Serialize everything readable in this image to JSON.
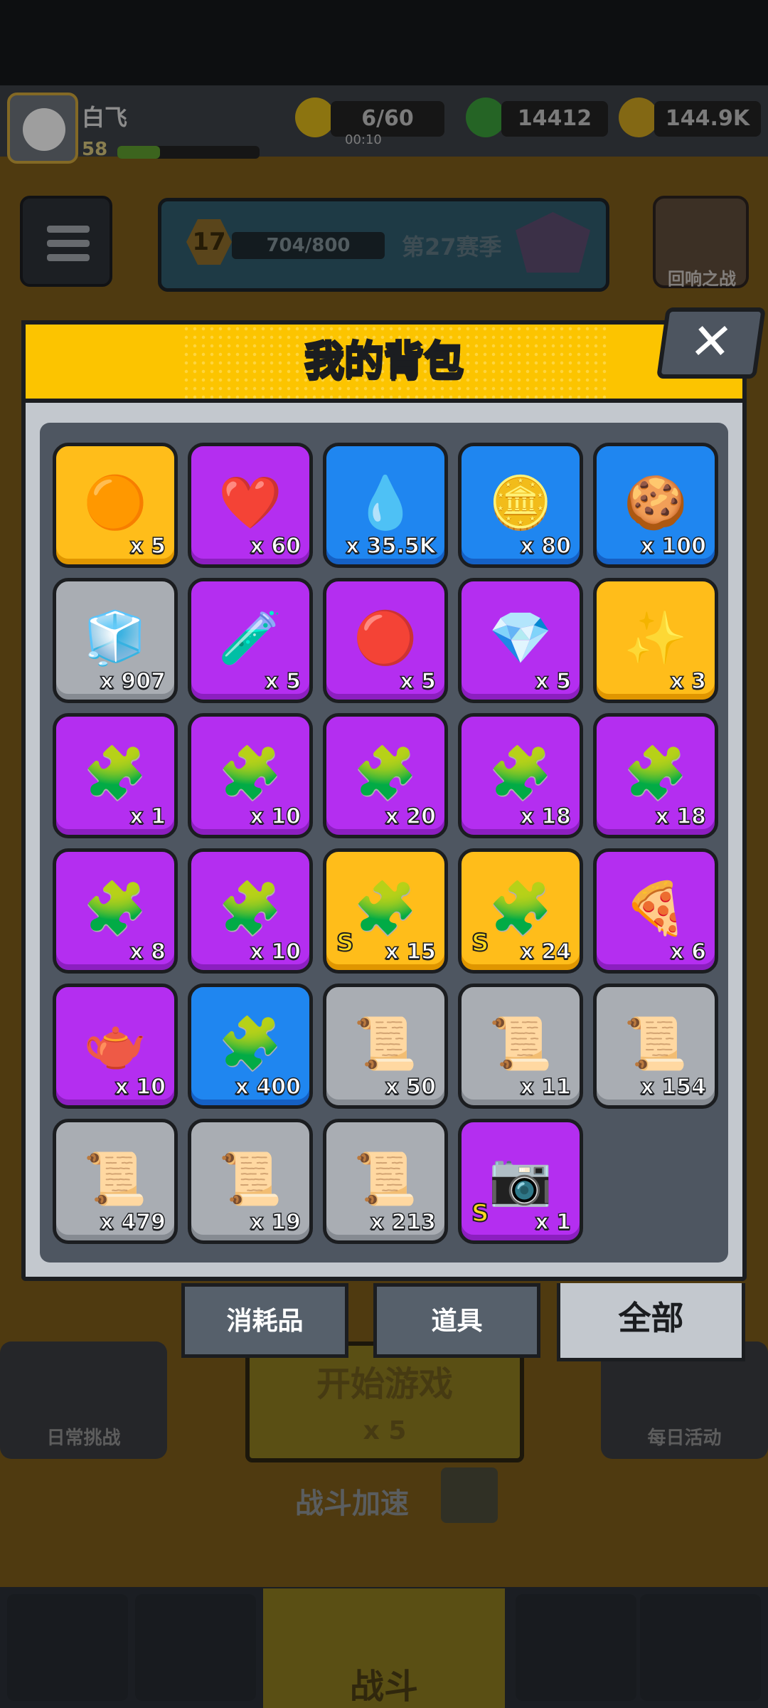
{
  "player": {
    "name": "白飞",
    "level": "58",
    "xp_fraction": 0.3
  },
  "resources": {
    "energy": "6/60",
    "energy_timer": "00:10",
    "gems": "14412",
    "coins": "144.9K"
  },
  "season": {
    "level": "17",
    "progress": "704/800",
    "name": "第27赛季"
  },
  "echo_battle": {
    "label": "回响之战"
  },
  "background": {
    "daily_challenge": "日常挑战",
    "daily_activity": "每日活动",
    "start_game": "开始游戏",
    "start_cost": "x 5",
    "battle_speed": "战斗加速",
    "nav_battle": "战斗"
  },
  "modal": {
    "title": "我的背包",
    "close_label": "✕",
    "tabs": [
      {
        "label": "消耗品",
        "active": false
      },
      {
        "label": "道具",
        "active": false
      },
      {
        "label": "全部",
        "active": true
      }
    ],
    "items": [
      {
        "icon": "orange-orb-icon",
        "glyph": "🟠",
        "rarity": "gold",
        "count": "x 5"
      },
      {
        "icon": "heart-icon",
        "glyph": "❤️",
        "rarity": "purple",
        "count": "x 60"
      },
      {
        "icon": "essence-drop-icon",
        "glyph": "💧",
        "rarity": "blue",
        "count": "x 35.5K"
      },
      {
        "icon": "gold-coin-icon",
        "glyph": "🪙",
        "rarity": "blue",
        "count": "x 80"
      },
      {
        "icon": "dog-cookie-icon",
        "glyph": "🍪",
        "rarity": "blue",
        "count": "x 100"
      },
      {
        "icon": "cube-icon",
        "glyph": "🧊",
        "rarity": "gray",
        "count": "x 907"
      },
      {
        "icon": "canister-icon",
        "glyph": "🧪",
        "rarity": "purple",
        "count": "x 5"
      },
      {
        "icon": "red-gem-orb-icon",
        "glyph": "🔴",
        "rarity": "purple",
        "count": "x 5"
      },
      {
        "icon": "purple-crystal-icon",
        "glyph": "💎",
        "rarity": "purple",
        "count": "x 5"
      },
      {
        "icon": "star-sparkle-icon",
        "glyph": "✨",
        "rarity": "gold",
        "count": "x 3"
      },
      {
        "icon": "hero-puzzle-icon",
        "glyph": "🧩",
        "rarity": "purple",
        "count": "x 1"
      },
      {
        "icon": "hero-puzzle-icon",
        "glyph": "🧩",
        "rarity": "purple",
        "count": "x 10"
      },
      {
        "icon": "hero-puzzle-icon",
        "glyph": "🧩",
        "rarity": "purple",
        "count": "x 20"
      },
      {
        "icon": "hero-puzzle-icon",
        "glyph": "🧩",
        "rarity": "purple",
        "count": "x 18"
      },
      {
        "icon": "hero-puzzle-icon",
        "glyph": "🧩",
        "rarity": "purple",
        "count": "x 18"
      },
      {
        "icon": "hero-puzzle-icon",
        "glyph": "🧩",
        "rarity": "purple",
        "count": "x 8"
      },
      {
        "icon": "hero-puzzle-icon",
        "glyph": "🧩",
        "rarity": "purple",
        "count": "x 10"
      },
      {
        "icon": "skull-puzzle-icon",
        "glyph": "🧩",
        "rarity": "gold",
        "count": "x 15",
        "s_rank": "S"
      },
      {
        "icon": "hero-puzzle-icon",
        "glyph": "🧩",
        "rarity": "gold",
        "count": "x 24",
        "s_rank": "S"
      },
      {
        "icon": "pizza-slice-icon",
        "glyph": "🍕",
        "rarity": "purple",
        "count": "x 6"
      },
      {
        "icon": "teapot-icon",
        "glyph": "🫖",
        "rarity": "purple",
        "count": "x 10"
      },
      {
        "icon": "blueprint-puzzle-icon",
        "glyph": "🧩",
        "rarity": "blue",
        "count": "x 400"
      },
      {
        "icon": "gun-scroll-icon",
        "glyph": "📜",
        "rarity": "gray",
        "count": "x 50"
      },
      {
        "icon": "shirt-scroll-icon",
        "glyph": "📜",
        "rarity": "gray",
        "count": "x 11"
      },
      {
        "icon": "necklace-scroll-icon",
        "glyph": "📜",
        "rarity": "gray",
        "count": "x 154"
      },
      {
        "icon": "belt-scroll-icon",
        "glyph": "📜",
        "rarity": "gray",
        "count": "x 479"
      },
      {
        "icon": "glove-scroll-icon",
        "glyph": "📜",
        "rarity": "gray",
        "count": "x 19"
      },
      {
        "icon": "boot-scroll-icon",
        "glyph": "📜",
        "rarity": "gray",
        "count": "x 213"
      },
      {
        "icon": "camera-chest-icon",
        "glyph": "📷",
        "rarity": "purple",
        "count": "x 1",
        "s_rank": "S"
      }
    ]
  },
  "colors": {
    "header_yellow": "#fcc400",
    "rarity_purple": "#b42ef0",
    "rarity_gold": "#ffbd1a",
    "rarity_blue": "#1f86f0",
    "rarity_gray": "#a9adb3"
  }
}
